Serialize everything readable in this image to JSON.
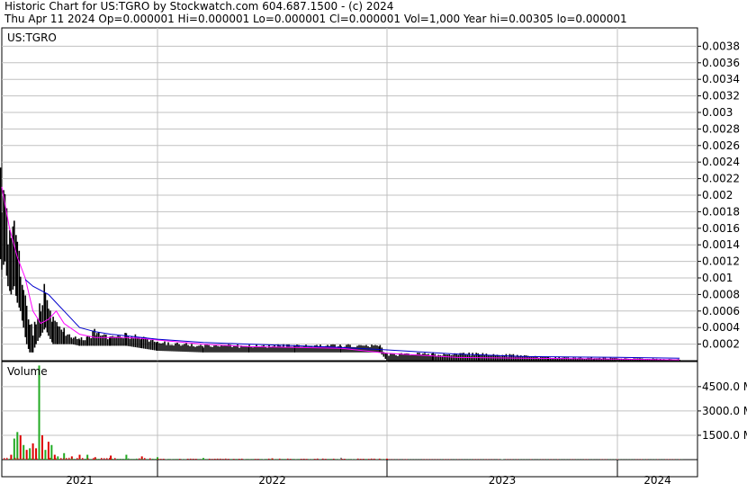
{
  "header": {
    "line1": "Historic Chart for US:TGRO by Stockwatch.com 604.687.1500 - (c) 2024",
    "line2": "Thu Apr 11 2024   Op=0.000001   Hi=0.000001   Lo=0.000001   Cl=0.000001   Vol=1,000   Year hi=0.00305   lo=0.000001"
  },
  "colors": {
    "grid": "#c0c0c0",
    "price_bars": "#000000",
    "ma_short": "#ff00ff",
    "ma_long": "#0000cc",
    "vol_up": "#22aa22",
    "vol_down": "#dd0000",
    "vol_flat": "#888888"
  },
  "chart_data": [
    {
      "type": "line",
      "title": "US:TGRO",
      "ylim": [
        0,
        0.004
      ],
      "y_ticks": [
        "0.0038",
        "0.0036",
        "0.0034",
        "0.0032",
        "0.003",
        "0.0028",
        "0.0026",
        "0.0024",
        "0.0022",
        "0.002",
        "0.0018",
        "0.0016",
        "0.0014",
        "0.0012",
        "0.001",
        "0.0008",
        "0.0006",
        "0.0004",
        "0.0002"
      ],
      "x_ticks": [
        "2021",
        "2022",
        "2023",
        "2024"
      ],
      "x_range": [
        2020.98,
        2024.35
      ],
      "series": [
        {
          "kind": "price_hilo",
          "x": [
            2020.98,
            2021.0,
            2021.02,
            2021.04,
            2021.06,
            2021.08,
            2021.1,
            2021.12,
            2021.14,
            2021.16,
            2021.18,
            2021.2,
            2021.22,
            2021.25,
            2021.28,
            2021.3,
            2021.33,
            2021.36,
            2021.4,
            2021.45,
            2021.5,
            2021.55,
            2021.6,
            2021.7,
            2021.8,
            2021.9,
            2022.0,
            2022.2,
            2022.4,
            2022.6,
            2022.8,
            2022.97,
            2023.0,
            2023.2,
            2023.4,
            2023.55,
            2023.7,
            2023.9,
            2024.1,
            2024.27
          ],
          "high": [
            0.0026,
            0.0023,
            0.0025,
            0.0017,
            0.0016,
            0.0017,
            0.0015,
            0.0013,
            0.00105,
            0.0009,
            0.0006,
            0.00045,
            0.0005,
            0.0008,
            0.001,
            0.0008,
            0.0006,
            0.00045,
            0.0004,
            0.0003,
            0.0003,
            0.0003,
            0.0004,
            0.0003,
            0.00035,
            0.0003,
            0.00025,
            0.0002,
            0.0002,
            0.0002,
            0.0002,
            0.0002,
            0.0001,
            0.0001,
            0.0001,
            8e-05,
            5e-05,
            4e-05,
            3e-05,
            2e-05
          ],
          "low": [
            0.0014,
            0.0011,
            0.0012,
            0.0009,
            0.0008,
            0.0009,
            0.0007,
            0.0006,
            0.0004,
            0.0002,
            0.0001,
            0.0001,
            0.0002,
            0.0003,
            0.0004,
            0.0003,
            0.0002,
            0.0002,
            0.0002,
            0.0002,
            0.00018,
            0.00018,
            0.00018,
            0.00018,
            0.00018,
            0.00015,
            0.00012,
            0.0001,
            0.0001,
            0.0001,
            0.0001,
            0.0001,
            1e-06,
            1e-06,
            1e-06,
            1e-06,
            1e-06,
            1e-06,
            1e-06,
            1e-06
          ]
        },
        {
          "kind": "moving_average_short",
          "x": [
            2021.0,
            2021.05,
            2021.1,
            2021.15,
            2021.2,
            2021.25,
            2021.3,
            2021.35,
            2021.4,
            2021.5,
            2021.6,
            2021.7,
            2021.8,
            2021.9,
            2022.0,
            2022.2,
            2022.4,
            2022.6,
            2022.8,
            2023.0,
            2023.3,
            2023.6,
            2024.0,
            2024.27
          ],
          "y": [
            0.0021,
            0.0016,
            0.00125,
            0.001,
            0.0006,
            0.00045,
            0.0005,
            0.0006,
            0.00045,
            0.00032,
            0.00028,
            0.00028,
            0.00028,
            0.00027,
            0.00025,
            0.0002,
            0.00017,
            0.00016,
            0.00015,
            9e-05,
            4e-05,
            3e-05,
            2e-05,
            1e-05
          ]
        },
        {
          "kind": "moving_average_long",
          "x": [
            2021.15,
            2021.2,
            2021.25,
            2021.3,
            2021.35,
            2021.4,
            2021.5,
            2021.6,
            2021.7,
            2021.8,
            2021.9,
            2022.0,
            2022.2,
            2022.4,
            2022.6,
            2022.8,
            2023.0,
            2023.3,
            2023.6,
            2024.0,
            2024.27
          ],
          "y": [
            0.00098,
            0.0009,
            0.00085,
            0.0008,
            0.0007,
            0.0006,
            0.0004,
            0.00035,
            0.00032,
            0.0003,
            0.00028,
            0.00026,
            0.00022,
            0.0002,
            0.00018,
            0.00016,
            0.00013,
            8e-05,
            5e-05,
            4e-05,
            3e-05
          ]
        }
      ]
    },
    {
      "type": "bar",
      "title": "Volume",
      "ylim": [
        0,
        5600
      ],
      "y_ticks": [
        "4500.0 M",
        "3000.0 M",
        "1500.0 M"
      ],
      "x": [
        2021.06,
        2021.08,
        2021.1,
        2021.12,
        2021.14,
        2021.16,
        2021.18,
        2021.2,
        2021.22,
        2021.24,
        2021.26,
        2021.28,
        2021.3,
        2021.32,
        2021.34,
        2021.36,
        2021.4,
        2021.45,
        2021.5,
        2021.55,
        2021.6,
        2021.7,
        2021.8,
        2021.9,
        2022.0,
        2022.2,
        2022.5,
        2022.8,
        2023.0,
        2023.5,
        2024.0
      ],
      "values": [
        300,
        1300,
        1700,
        1500,
        900,
        600,
        700,
        1000,
        700,
        5800,
        1500,
        600,
        1100,
        900,
        300,
        200,
        400,
        200,
        300,
        300,
        150,
        250,
        300,
        200,
        150,
        100,
        80,
        120,
        60,
        30,
        20
      ],
      "dir": [
        "down",
        "up",
        "up",
        "down",
        "up",
        "down",
        "up",
        "down",
        "down",
        "up",
        "down",
        "up",
        "down",
        "up",
        "down",
        "up",
        "up",
        "down",
        "down",
        "up",
        "down",
        "down",
        "up",
        "down",
        "up",
        "up",
        "down",
        "flat",
        "down",
        "flat",
        "flat"
      ]
    }
  ]
}
